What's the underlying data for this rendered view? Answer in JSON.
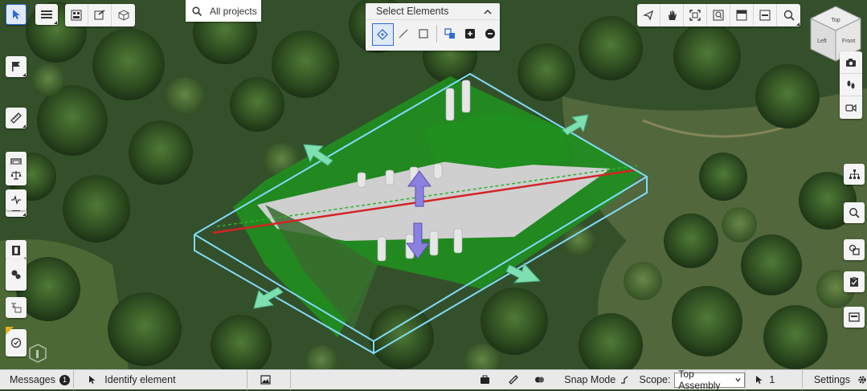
{
  "search": {
    "label": "All projects"
  },
  "select_panel": {
    "title": "Select Elements"
  },
  "view_cube": {
    "top": "Top",
    "left": "Left",
    "front": "Front"
  },
  "status_bar": {
    "messages_label": "Messages",
    "messages_count": "1",
    "identify_label": "Identify element",
    "snap_mode_label": "Snap Mode",
    "scope_label": "Scope:",
    "scope_value": "Top Assembly",
    "selected_count": "1",
    "settings_label": "Settings"
  },
  "colors": {
    "accent": "#2e6bd6",
    "bounding_box": "#7fdcff",
    "model_green": "#1f8f1f",
    "gizmo_green": "#7ee0b0",
    "gizmo_purple": "#9a90e8",
    "centerline": "#d32424"
  },
  "icons": [
    "cursor-icon",
    "menu-icon",
    "flag-icon",
    "measure-icon",
    "box-icon",
    "section-icon",
    "film-icon",
    "balance-icon",
    "pulse-icon",
    "palette-icon",
    "translate-icon",
    "check-circle-icon",
    "search-icon",
    "move-icon",
    "hand-icon",
    "fit-icon",
    "zoom-window-icon",
    "camera-icon",
    "footsteps-icon",
    "video-icon",
    "tree-icon",
    "magnifier-icon",
    "shapes-icon",
    "clipboard-icon",
    "frame-icon",
    "gear-icon"
  ]
}
